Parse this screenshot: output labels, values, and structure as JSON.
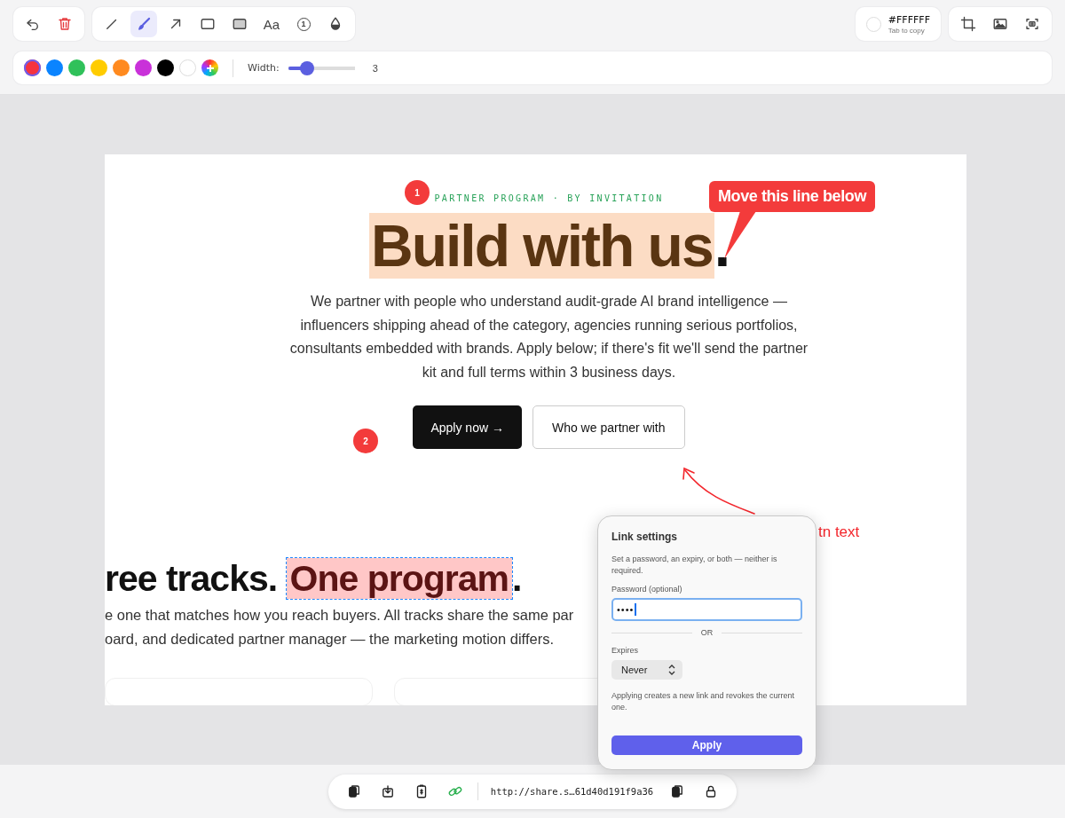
{
  "history_tools": [
    {
      "kind": "undo"
    },
    {
      "kind": "delete"
    }
  ],
  "tools": [
    {
      "kind": "pen",
      "selected": false
    },
    {
      "kind": "brush",
      "selected": true
    },
    {
      "kind": "arrow",
      "selected": false
    },
    {
      "kind": "rect",
      "selected": false
    },
    {
      "kind": "filled-rect",
      "selected": false
    },
    {
      "kind": "text",
      "label": "Aa",
      "selected": false
    },
    {
      "kind": "counter",
      "label": "1",
      "selected": false
    },
    {
      "kind": "blur",
      "selected": false
    }
  ],
  "color_picker": {
    "color": "#ffffff",
    "hex": "#FFFFFF",
    "hint": "Tab to copy"
  },
  "image_tools": [
    {
      "kind": "crop"
    },
    {
      "kind": "image"
    },
    {
      "kind": "capture"
    }
  ],
  "colors": [
    {
      "color": "#f5333f",
      "selected": true
    },
    {
      "color": "#0a84ff",
      "selected": false
    },
    {
      "color": "#30c15a",
      "selected": false
    },
    {
      "color": "#ffcc00",
      "selected": false
    },
    {
      "color": "#ff8a1f",
      "selected": false
    },
    {
      "color": "#c931d9",
      "selected": false
    },
    {
      "color": "#000000",
      "selected": false
    },
    {
      "color": "#ffffff",
      "selected": false
    },
    {
      "kind": "custom"
    }
  ],
  "width": {
    "label": "Width:",
    "level": 0.28,
    "reading": "3"
  },
  "page": {
    "eyebrow": "PARTNER PROGRAM · BY INVITATION",
    "heading": "Build with us",
    "heading_end": ".",
    "intro": "We partner with people who understand audit-grade AI brand intelligence — influencers shipping ahead of the category, agencies running serious portfolios, consultants embedded with brands. Apply below; if there's fit we'll send the partner kit and full terms within 3 business days.",
    "primary_button": "Apply now →",
    "secondary_button": "Who we partner with",
    "section_heading": "ree tracks.",
    "section_highlight": "One program",
    "section_heading_end": ".",
    "section_lines": [
      "e one that matches how you reach buyers. All tracks share the same par",
      "oard, and dedicated partner manager — the marketing motion differs."
    ]
  },
  "annotations": [
    {
      "kind": "badge",
      "text": "1"
    },
    {
      "kind": "callout",
      "text": "Move this line below"
    },
    {
      "kind": "badge",
      "text": "2"
    },
    {
      "kind": "note",
      "text": "tn text"
    }
  ],
  "link_settings": {
    "title": "Link settings",
    "description": "Set a password, an expiry, or both — neither is required.",
    "password_label": "Password (optional)",
    "password_value": "••••",
    "divider": "OR",
    "expires_label": "Expires",
    "expires_value": "Never",
    "note": "Applying creates a new link and revokes the current one.",
    "apply": "Apply"
  },
  "share_bar": {
    "actions": [
      {
        "kind": "copy",
        "active": false
      },
      {
        "kind": "download",
        "active": false
      },
      {
        "kind": "clipboard",
        "active": false
      },
      {
        "kind": "link",
        "active": true
      }
    ],
    "url": "http://share.s…61d40d191f9a36",
    "trailing": [
      {
        "kind": "copy",
        "active": false
      },
      {
        "kind": "lock",
        "active": false
      }
    ]
  }
}
